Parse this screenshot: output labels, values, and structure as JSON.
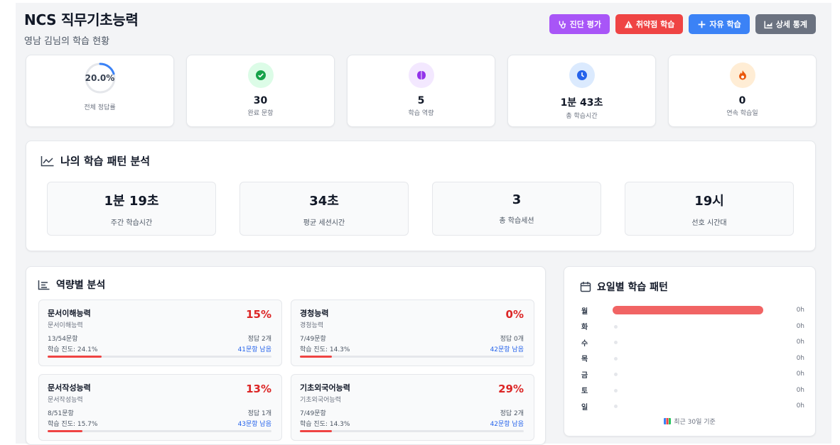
{
  "header": {
    "title": "NCS 직무기초능력",
    "subtitle": "영남 김님의 학습 현황"
  },
  "actions": [
    {
      "label": "진단 평가",
      "icon": "stethoscope-icon",
      "color": "#a855f7"
    },
    {
      "label": "취약점 학습",
      "icon": "warning-icon",
      "color": "#ef4444"
    },
    {
      "label": "자유 학습",
      "icon": "plus-icon",
      "color": "#3b82f6"
    },
    {
      "label": "상세 통계",
      "icon": "chart-icon",
      "color": "#6b7280"
    }
  ],
  "summary": {
    "accuracy": {
      "value": "20.0%",
      "label": "전체 정답률",
      "fraction": 0.2
    },
    "completed": {
      "value": "30",
      "label": "완료 문항",
      "icon": "check-circle-icon"
    },
    "competencies": {
      "value": "5",
      "label": "학습 역량",
      "icon": "brain-icon"
    },
    "total_time": {
      "value": "1분 43초",
      "label": "총 학습시간",
      "icon": "clock-icon"
    },
    "streak": {
      "value": "0",
      "label": "연속 학습일",
      "icon": "fire-icon"
    }
  },
  "pattern": {
    "title": "나의 학습 패턴 분석",
    "metrics": [
      {
        "value": "1분 19초",
        "label": "주간 학습시간"
      },
      {
        "value": "34초",
        "label": "평균 세션시간"
      },
      {
        "value": "3",
        "label": "총 학습세션"
      },
      {
        "value": "19시",
        "label": "선호 시간대"
      }
    ]
  },
  "competency_analysis": {
    "title": "역량별 분석",
    "items": [
      {
        "name": "문서이해능력",
        "sub": "문서이해능력",
        "pct": "15%",
        "questions": "13/54문항",
        "correct": "정답 2개",
        "progress_label": "학습 진도: 24.1%",
        "remaining": "41문항 남음",
        "progress": 0.241
      },
      {
        "name": "경청능력",
        "sub": "경청능력",
        "pct": "0%",
        "questions": "7/49문항",
        "correct": "정답 0개",
        "progress_label": "학습 진도: 14.3%",
        "remaining": "42문항 남음",
        "progress": 0.143
      },
      {
        "name": "문서작성능력",
        "sub": "문서작성능력",
        "pct": "13%",
        "questions": "8/51문항",
        "correct": "정답 1개",
        "progress_label": "학습 진도: 15.7%",
        "remaining": "43문항 남음",
        "progress": 0.157
      },
      {
        "name": "기초외국어능력",
        "sub": "기초외국어능력",
        "pct": "29%",
        "questions": "7/49문항",
        "correct": "정답 2개",
        "progress_label": "학습 진도: 14.3%",
        "remaining": "42문항 남음",
        "progress": 0.143
      }
    ]
  },
  "weekly": {
    "title": "요일별 학습 패턴",
    "days": [
      {
        "day": "월",
        "value": "0h",
        "level": 1.0
      },
      {
        "day": "화",
        "value": "0h",
        "level": 0
      },
      {
        "day": "수",
        "value": "0h",
        "level": 0
      },
      {
        "day": "목",
        "value": "0h",
        "level": 0
      },
      {
        "day": "금",
        "value": "0h",
        "level": 0
      },
      {
        "day": "토",
        "value": "0h",
        "level": 0
      },
      {
        "day": "일",
        "value": "0h",
        "level": 0
      }
    ],
    "footer": "최근 30일 기준"
  },
  "colors": {
    "accent_red": "#ef4444",
    "link_blue": "#2563eb",
    "ring_blue": "#3b82f6"
  }
}
